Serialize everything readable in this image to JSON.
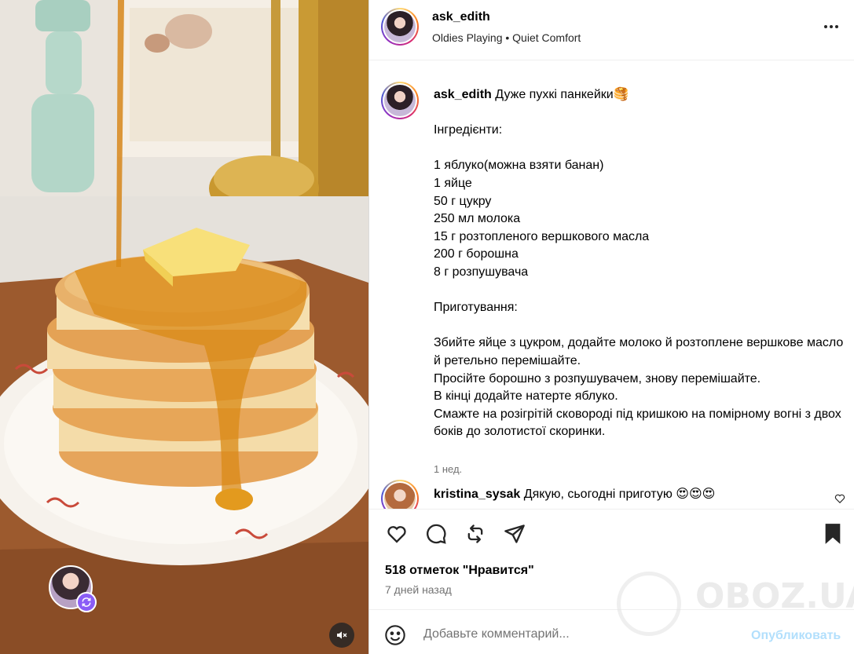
{
  "header": {
    "username": "ask_edith",
    "subtitle": "Oldies Playing • Quiet Comfort",
    "more_icon": "more-horizontal-icon"
  },
  "caption": {
    "username": "ask_edith",
    "title": "Дуже пухкі панкейки🥞",
    "lines": [
      "",
      "Інгредієнти:",
      "",
      "1 яблуко(можна взяти банан)",
      "1 яйце",
      "50 г цукру",
      "250 мл молока",
      "15 г розтопленого вершкового масла",
      "200 г борошна",
      "8 г розпушувача",
      "",
      "Приготування:",
      "",
      "Збийте яйце з цукром, додайте молоко й розтоплене вершкове масло й ретельно перемішайте.",
      "Просійте борошно з розпушувачем, знову перемішайте.",
      "В кінці додайте натерте яблуко.",
      "Смажте на розігрітій сковороді під кришкою на помірному вогні з двох боків до золотистої скоринки."
    ],
    "time": "1 нед."
  },
  "comment": {
    "username": "kristina_sysak",
    "text": "Дякую, сьогодні приготую 😍😍😍"
  },
  "actions": {
    "likes": "518 отметок \"Нравится\"",
    "date": "7 дней назад"
  },
  "add_comment": {
    "placeholder": "Добавьте комментарий...",
    "post_label": "Опубликовать"
  },
  "watermark": {
    "text": "OBOZ.UA"
  },
  "colors": {
    "accent": "#0095f6",
    "post_disabled": "#b2dffc",
    "secondary_text": "#737373",
    "repost_badge": "#8a5cf6"
  }
}
